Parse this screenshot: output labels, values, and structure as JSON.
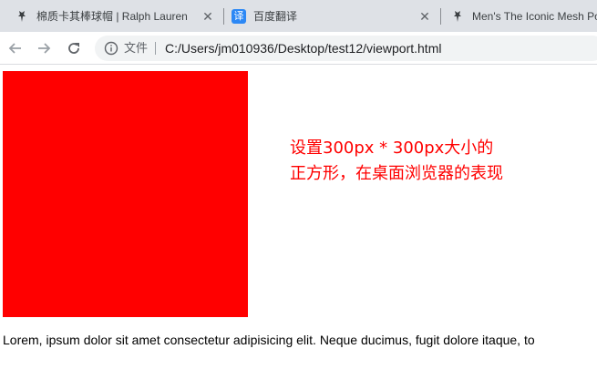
{
  "browser": {
    "tabs": [
      {
        "title": "棉质卡其棒球帽 | Ralph Lauren",
        "favicon": "ralph-lauren-polo-icon"
      },
      {
        "title": "百度翻译",
        "favicon": "baidu-translate-icon",
        "favicon_text": "译",
        "favicon_color": "#2c88f5"
      },
      {
        "title": "Men's The Iconic Mesh Po",
        "favicon": "ralph-lauren-polo-icon"
      }
    ],
    "close_glyph": "✕",
    "address": {
      "scheme_label": "文件",
      "url": "C:/Users/jm010936/Desktop/test12/viewport.html"
    }
  },
  "page": {
    "square_color": "#ff0000",
    "note_lines": [
      "设置300px * 300px大小的",
      "正方形，在桌面浏览器的表现"
    ],
    "note_color": "#ff0000",
    "paragraph": "Lorem, ipsum dolor sit amet consectetur adipisicing elit. Neque ducimus, fugit dolore itaque, to"
  }
}
